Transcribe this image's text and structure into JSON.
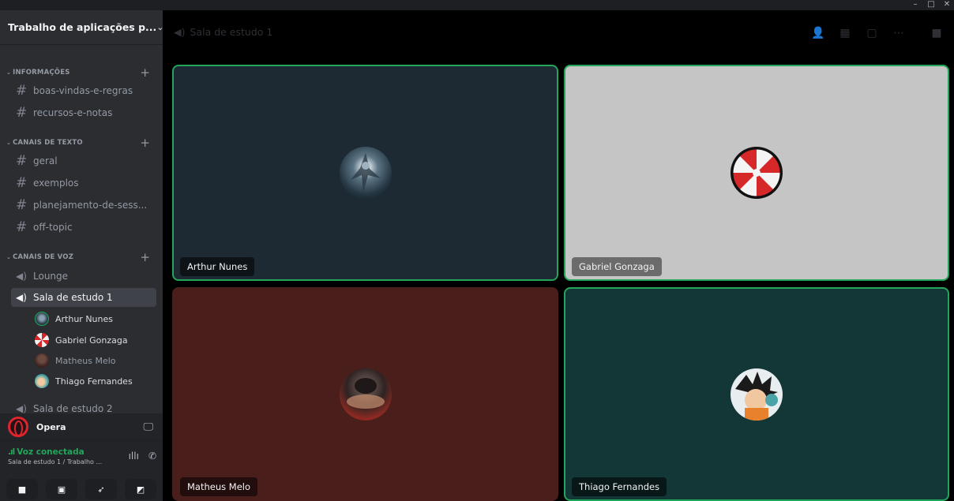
{
  "window": {
    "minimize": "–",
    "maximize": "□",
    "close": "✕"
  },
  "server": {
    "name": "Trabalho de aplicações p...",
    "chevron": "⌄"
  },
  "categories": [
    {
      "label": "INFORMAÇÕES",
      "caret": "⌄",
      "add": "+"
    },
    {
      "label": "CANAIS DE TEXTO",
      "caret": "⌄",
      "add": "+"
    },
    {
      "label": "CANAIS DE VOZ",
      "caret": "⌄",
      "add": "+"
    }
  ],
  "text_channels": [
    {
      "name": "boas-vindas-e-regras"
    },
    {
      "name": "recursos-e-notas"
    },
    {
      "name": "geral"
    },
    {
      "name": "exemplos"
    },
    {
      "name": "planejamento-de-sess..."
    },
    {
      "name": "off-topic"
    }
  ],
  "voice_channels": [
    {
      "name": "Lounge"
    },
    {
      "name": "Sala de estudo 1"
    },
    {
      "name": "Sala de estudo 2"
    }
  ],
  "voice_users": [
    {
      "name": "Arthur Nunes"
    },
    {
      "name": "Gabriel Gonzaga"
    },
    {
      "name": "Matheus Melo"
    },
    {
      "name": "Thiago Fernandes"
    }
  ],
  "activity": {
    "name": "Opera"
  },
  "voice_status": {
    "title": "Voz conectada",
    "subtitle": "Sala de estudo 1 / Trabalho ...",
    "signal_glyph": ".ıl",
    "noise_glyph": "ıllı",
    "disconnect_glyph": "✆"
  },
  "main": {
    "channel_title": "Sala de estudo 1",
    "speaker_glyph": "🔈",
    "tiles": [
      {
        "name": "Arthur Nunes",
        "bg": "#1e2a33"
      },
      {
        "name": "Gabriel Gonzaga",
        "bg": "#c5c5c5"
      },
      {
        "name": "Matheus Melo",
        "bg": "#4a1e1b"
      },
      {
        "name": "Thiago Fernandes",
        "bg": "#133636"
      }
    ],
    "speaking_border_color": "#23a55a"
  },
  "icons": {
    "hash": "#",
    "speaker": "◀)",
    "add_user": "👤",
    "grid": "▦",
    "chat": "▢",
    "more": "⋯",
    "inbox": "■",
    "screen": "🖵",
    "camera": "■",
    "share": "▣",
    "activity": "➶",
    "soundboard": "◩"
  }
}
